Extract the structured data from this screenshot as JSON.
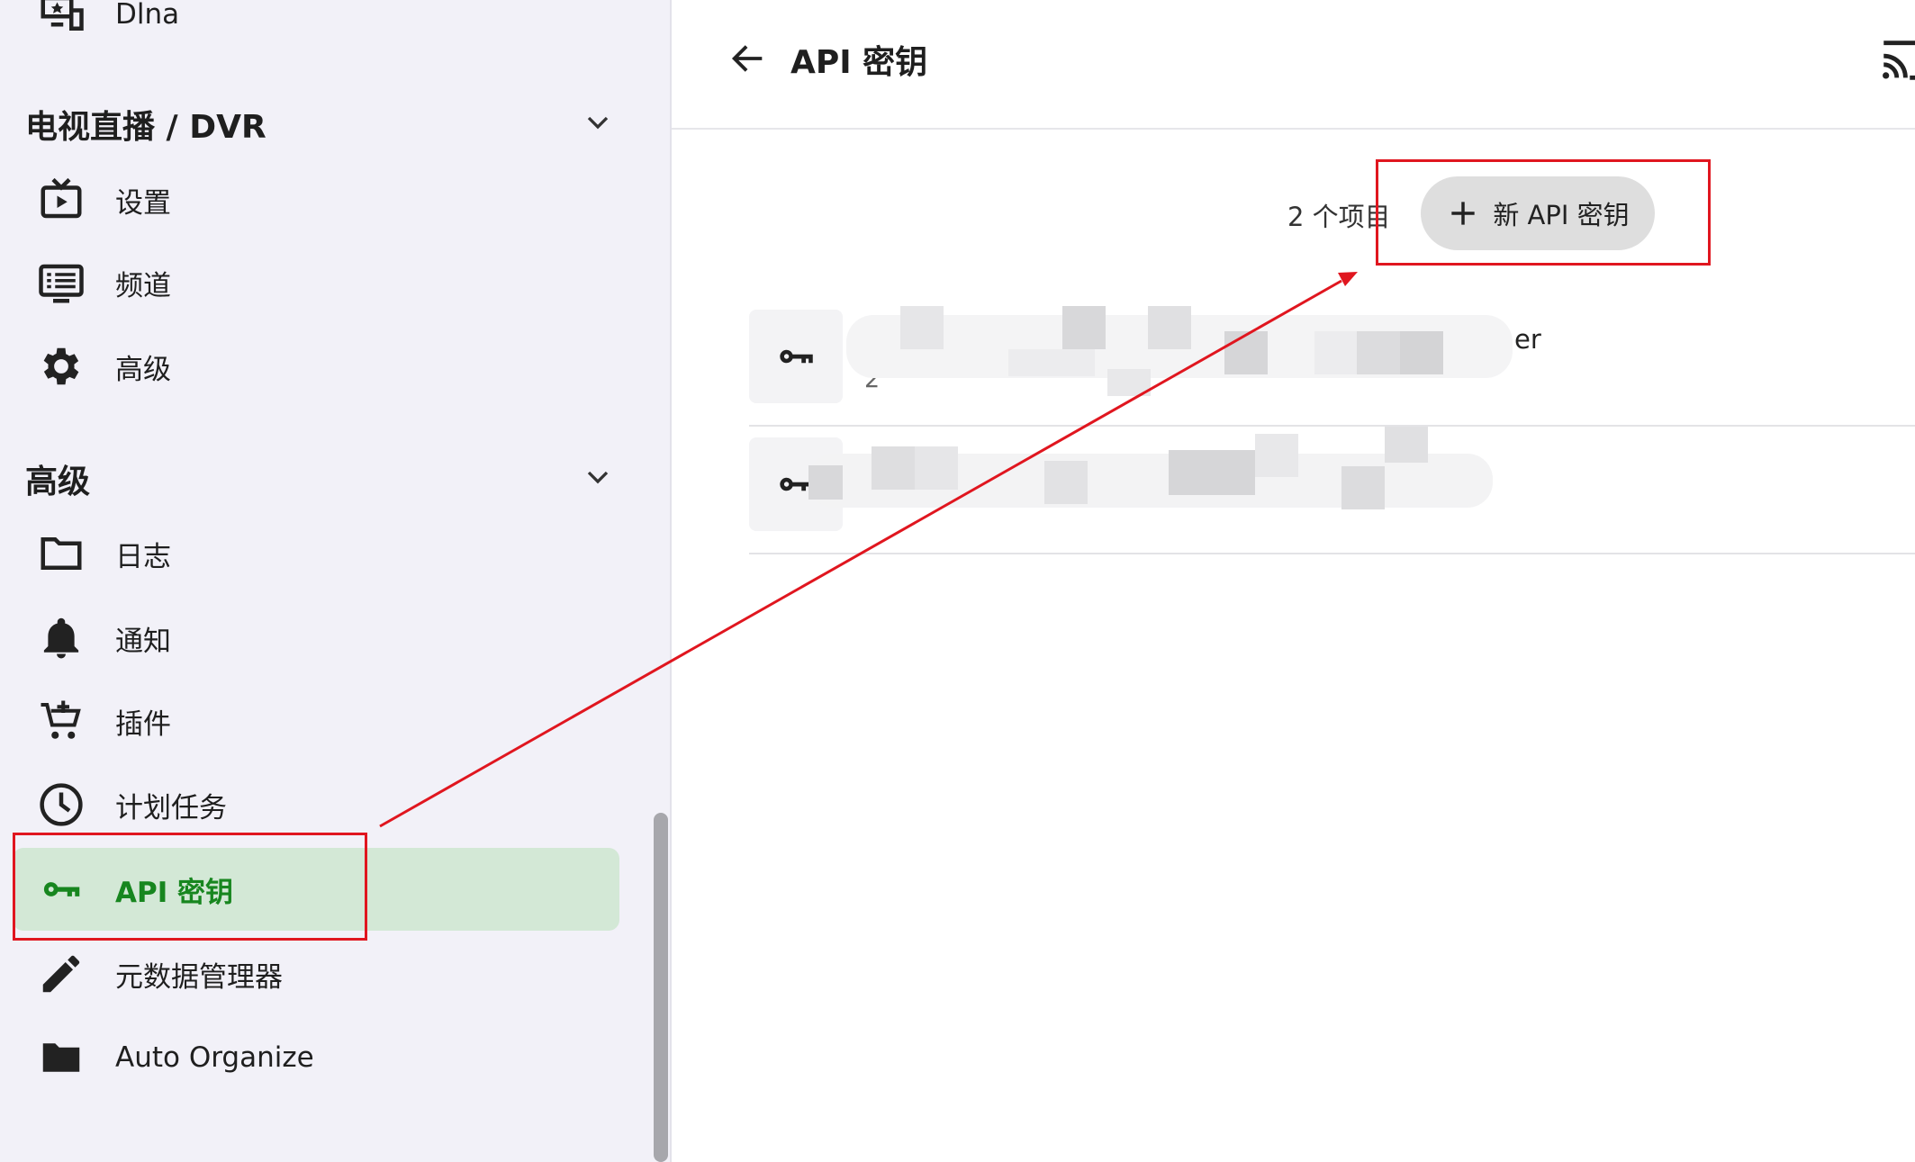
{
  "sidebar": {
    "dlna_label": "Dlna",
    "sections": [
      {
        "title": "电视直播 / DVR"
      },
      {
        "title": "高级"
      }
    ],
    "livetv_items": [
      {
        "label": "设置",
        "icon": "tv-play-icon"
      },
      {
        "label": "频道",
        "icon": "channel-list-icon"
      },
      {
        "label": "高级",
        "icon": "gear-icon"
      }
    ],
    "advanced_items": [
      {
        "label": "日志",
        "icon": "folder-outline-icon"
      },
      {
        "label": "通知",
        "icon": "bell-icon"
      },
      {
        "label": "插件",
        "icon": "cart-plus-icon"
      },
      {
        "label": "计划任务",
        "icon": "clock-icon"
      },
      {
        "label": "API 密钥",
        "icon": "key-icon",
        "active": true
      },
      {
        "label": "元数据管理器",
        "icon": "pencil-icon"
      },
      {
        "label": "Auto Organize",
        "icon": "folder-icon"
      }
    ]
  },
  "header": {
    "title": "API 密钥"
  },
  "content": {
    "item_count": "2 个项目",
    "new_button_label": "新 API 密钥",
    "rows": [
      {
        "primary_visible": "er",
        "secondary_visible": "2"
      },
      {
        "primary_visible": "",
        "secondary_visible": ""
      }
    ]
  },
  "colors": {
    "active_green": "#17861f",
    "active_bg": "#d3e8d6",
    "annotation_red": "#e0161f",
    "sidebar_bg": "#f2f1f8"
  }
}
